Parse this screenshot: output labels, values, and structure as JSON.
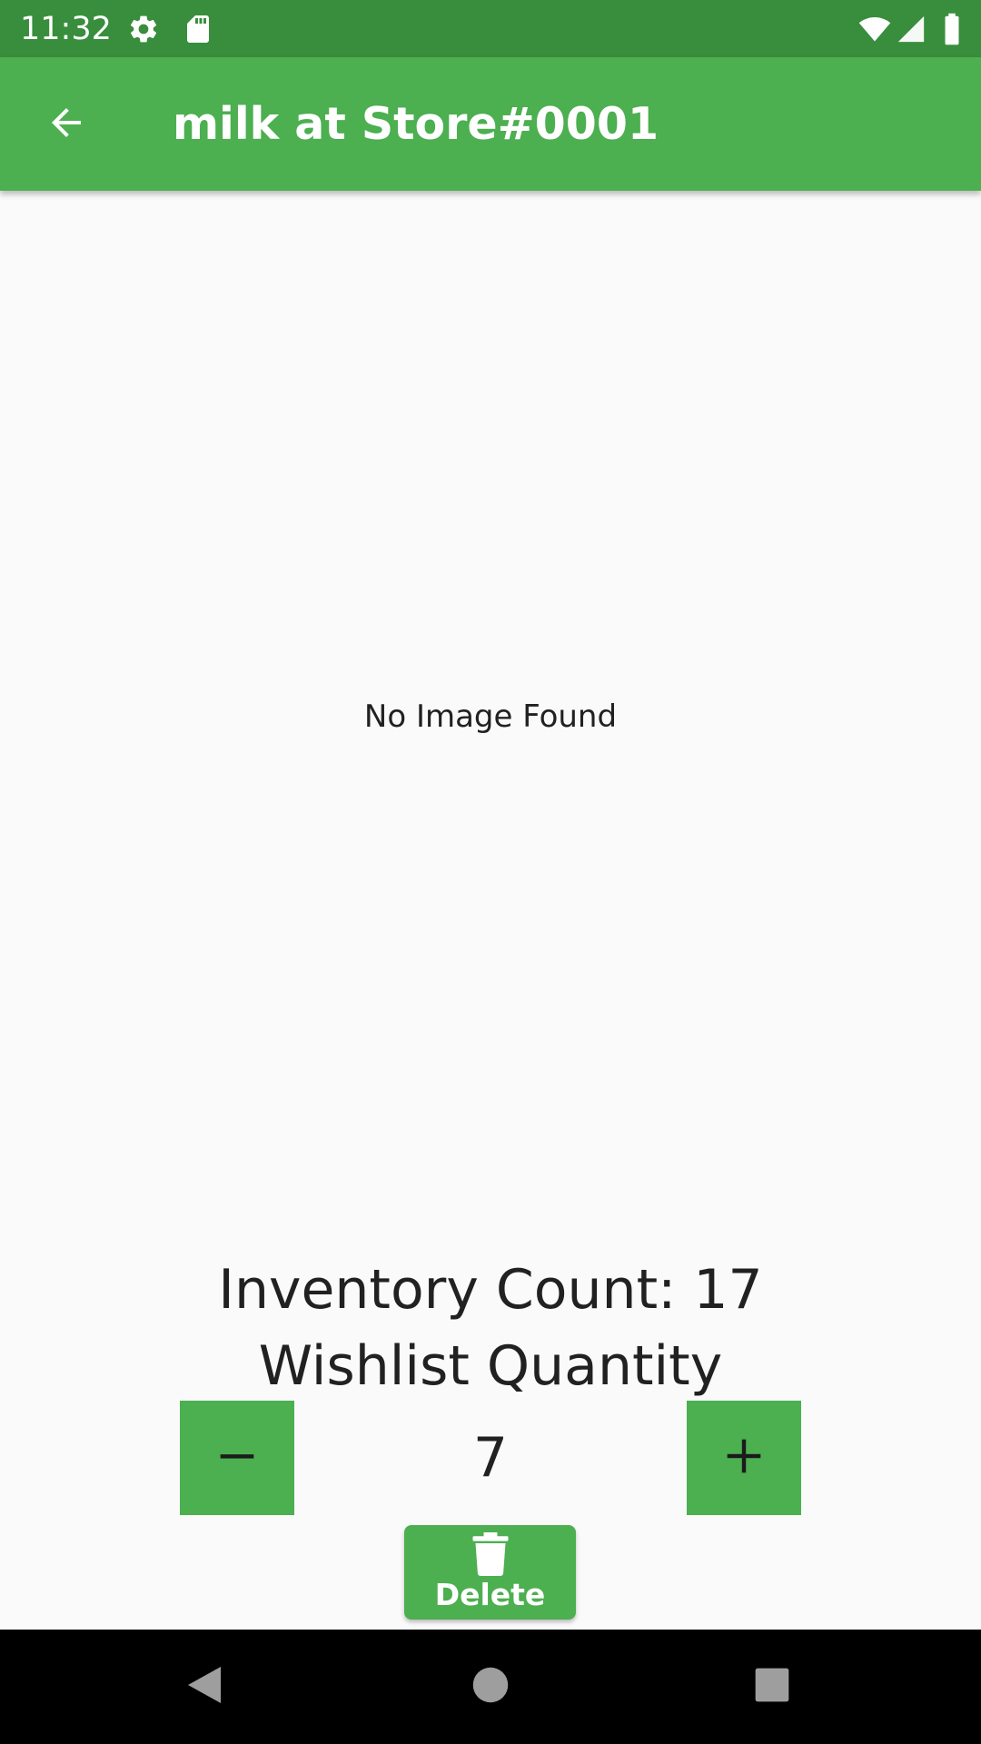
{
  "status_bar": {
    "time": "11:32",
    "icons": [
      "gear-icon",
      "sd-card-icon",
      "wifi-icon",
      "signal-icon",
      "battery-icon"
    ]
  },
  "app_bar": {
    "title": "milk at Store#0001",
    "back_icon": "arrow-back-icon"
  },
  "main": {
    "no_image_text": "No Image Found",
    "inventory_count_text": "Inventory Count: 17",
    "wishlist_label": "Wishlist Quantity",
    "wishlist_quantity": "7",
    "decrement_symbol": "−",
    "increment_symbol": "+",
    "delete_label": "Delete"
  },
  "nav_bar": {
    "icons": [
      "back-triangle-icon",
      "home-circle-icon",
      "recents-square-icon"
    ]
  },
  "colors": {
    "status_bar": "#388e3c",
    "primary": "#4caf50",
    "background": "#fafafa",
    "text": "#212121"
  }
}
